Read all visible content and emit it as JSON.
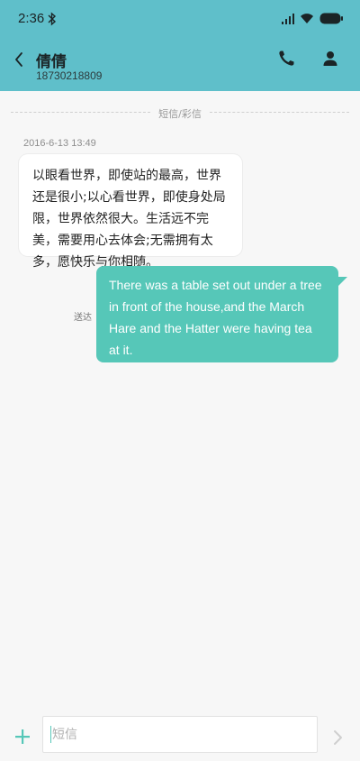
{
  "status_bar": {
    "time": "2:36",
    "icons": [
      "bluetooth-icon",
      "signal-icon",
      "wifi-icon",
      "battery-icon"
    ]
  },
  "header": {
    "contact_name": "倩倩",
    "contact_number": "18730218809",
    "icons": [
      "back-arrow-icon",
      "phone-icon",
      "person-icon"
    ]
  },
  "conversation": {
    "divider_label": "短信/彩信",
    "timestamp": "2016-6-13 13:49",
    "incoming_message": "以眼看世界，即使站的最高，世界还是很小;以心看世界，即使身处局限，世界依然很大。生活远不完美，需要用心去体会;无需拥有太多，愿快乐与你相随。",
    "outgoing_message": "There was a table set out under a tree in front of the house,and the March Hare and the Hatter were having tea at it.",
    "sent_status": "送达"
  },
  "composer": {
    "placeholder": "短信",
    "value": "",
    "icons": [
      "plus-icon",
      "send-arrow-icon"
    ]
  },
  "colors": {
    "header": "#5fbfca",
    "accent": "#56c7b8",
    "background": "#f7f7f7"
  }
}
